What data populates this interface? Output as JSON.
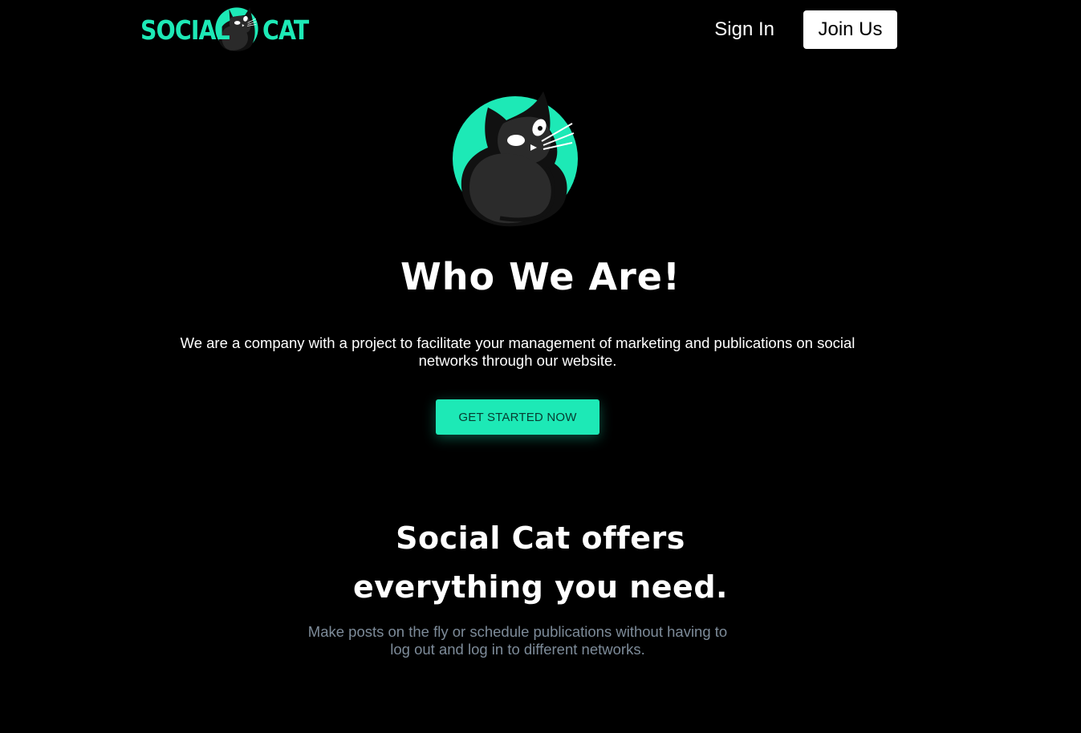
{
  "header": {
    "logo": {
      "word1": "SOCIAL",
      "word2": "CAT"
    },
    "nav": {
      "sign_in": "Sign In",
      "join_us": "Join Us"
    }
  },
  "hero": {
    "title": "Who We Are!",
    "description": "We are a company with a project to facilitate your management of marketing and publications on social networks through our website.",
    "cta_label": "GET STARTED NOW"
  },
  "features": {
    "title_line1": "Social Cat offers",
    "title_line2": "everything you need.",
    "subtitle": "Make posts on the fly or schedule publications without having to log out and log in to different networks."
  },
  "colors": {
    "accent": "#1de9b6",
    "background": "#000000",
    "muted_text": "#7d8b99"
  },
  "icons": {
    "logo_mark": "cat-icon",
    "hero_mark": "cat-icon"
  }
}
